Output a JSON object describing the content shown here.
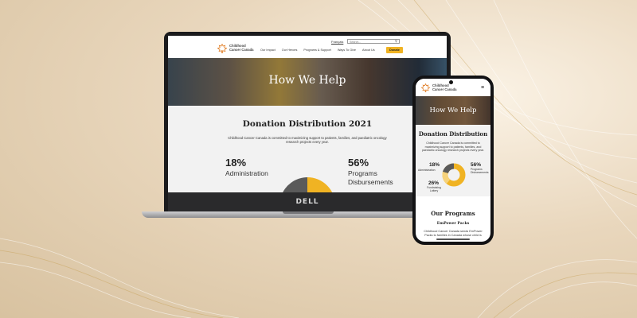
{
  "desktop": {
    "logo_text_line1": "Childhood",
    "logo_text_line2": "Cancer Canada",
    "language_link": "Français",
    "search_placeholder": "Search...",
    "nav": [
      "Our Impact",
      "Our Heroes",
      "Programs & Support",
      "Ways To Give",
      "About Us"
    ],
    "donate_label": "Donate",
    "hero_title": "How We Help",
    "donation_title": "Donation Distribution 2021",
    "donation_text": "Childhood Cancer Canada is committed to maximizing support to patients, families, and paediatric oncology research projects every year.",
    "admin_pct": "18%",
    "admin_label": "Administration",
    "programs_pct": "56%",
    "programs_label_line1": "Programs",
    "programs_label_line2": "Disbursements",
    "laptop_brand": "DELL"
  },
  "mobile": {
    "logo_text_line1": "Childhood",
    "logo_text_line2": "Cancer Canada",
    "menu_icon": "hamburger-icon",
    "hero_title": "How We Help",
    "donation_title": "Donation Distribution",
    "donation_text": "Childhood Cancer Canada is committed to maximizing support to patients, families, and paediatric oncology research projects every year.",
    "admin_pct": "18%",
    "admin_label": "Administration",
    "programs_pct": "56%",
    "programs_label_line1": "Programs",
    "programs_label_line2": "Disbursements",
    "fundraising_pct": "26%",
    "fundraising_label_line1": "Fundraising",
    "fundraising_label_line2": "Lottery",
    "programs_title": "Our Programs",
    "empower_title": "EmPower Packs",
    "empower_text": "Childhood Cancer Canada sends EmPower Packs to families in Canada whose child is"
  },
  "colors": {
    "accent": "#f0b323",
    "dark_slice": "#5a5a5a",
    "light_slice": "#f6d27a"
  }
}
